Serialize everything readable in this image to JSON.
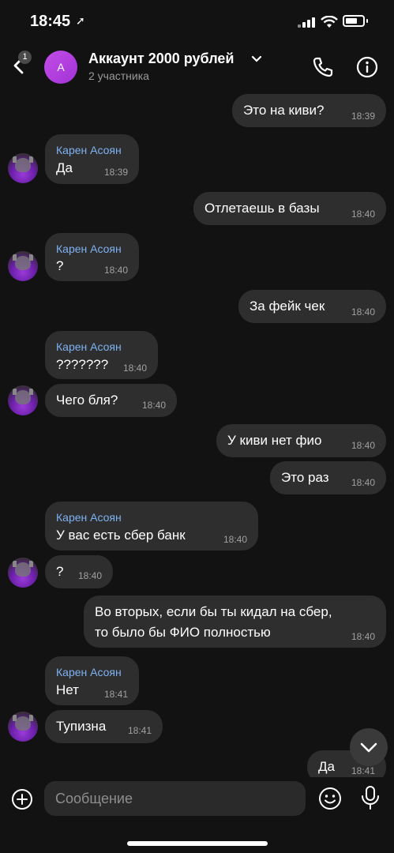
{
  "status": {
    "time": "18:45"
  },
  "header": {
    "badge": "1",
    "avatar_letter": "А",
    "title": "Аккаунт 2000 рублей",
    "subtitle": "2 участника"
  },
  "messages": [
    {
      "side": "out",
      "text": "Это на киви?",
      "time": "18:39"
    },
    {
      "side": "in",
      "sender": "Карен Асоян",
      "text": "Да",
      "time": "18:39"
    },
    {
      "side": "out",
      "text": "Отлетаешь в базы",
      "time": "18:40"
    },
    {
      "side": "in",
      "sender": "Карен Асоян",
      "text": "?",
      "time": "18:40"
    },
    {
      "side": "out",
      "text": "За фейк чек",
      "time": "18:40"
    },
    {
      "side": "in",
      "sender": "Карен Асоян",
      "text": "???????",
      "time": "18:40"
    },
    {
      "side": "in",
      "text": "Чего бля?",
      "time": "18:40"
    },
    {
      "side": "out",
      "text": "У киви нет фио",
      "time": "18:40"
    },
    {
      "side": "out",
      "text": "Это раз",
      "time": "18:40"
    },
    {
      "side": "in",
      "sender": "Карен Асоян",
      "text": "У вас есть сбер банк",
      "time": "18:40"
    },
    {
      "side": "in",
      "text": "?",
      "time": "18:40"
    },
    {
      "side": "out",
      "text": "Во вторых, если бы ты кидал на сбер,",
      "text2": "то было бы ФИО полностью",
      "time": "18:40"
    },
    {
      "side": "in",
      "sender": "Карен Асоян",
      "text": "Нет",
      "time": "18:41"
    },
    {
      "side": "in",
      "text": "Тупизна",
      "time": "18:41"
    },
    {
      "side": "out",
      "text": "Да",
      "time": "18:41"
    }
  ],
  "composer": {
    "placeholder": "Сообщение"
  },
  "colors": {
    "bubble": "#2e2e2e",
    "sender": "#7eb2f2",
    "avatar_accent": "#b43fe0",
    "background": "#121212"
  }
}
